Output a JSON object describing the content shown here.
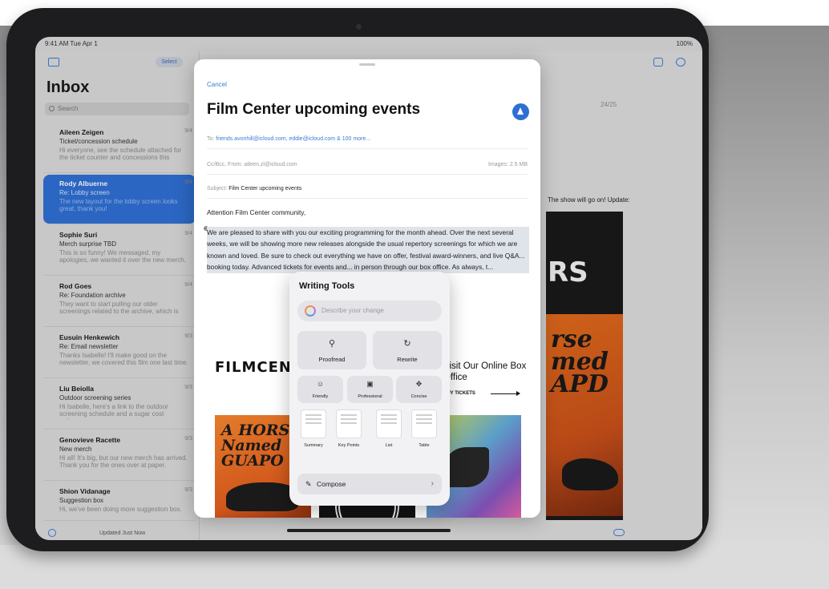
{
  "status_bar": {
    "time": "9:41 AM  Tue Apr 1",
    "battery": "100%"
  },
  "mailbox": {
    "select_label": "Select",
    "title": "Inbox",
    "search_placeholder": "Search",
    "updated": "Updated Just Now",
    "rows": [
      {
        "sender": "Aileen Zeigen",
        "subject": "Ticket/concession schedule",
        "preview": "Hi everyone, see the schedule attached for the ticket counter and concessions this",
        "date": "9/4"
      },
      {
        "sender": "Rody Albuerne",
        "subject": "Re: Lobby screen",
        "preview": "The new layout for the lobby screen looks great, thank you!",
        "date": "9/4"
      },
      {
        "sender": "Sophie Suri",
        "subject": "Merch surprise TBD",
        "preview": "This is so funny! We messaged, my apologies, we wanted it over the new merch.",
        "date": "9/4"
      },
      {
        "sender": "Rod Goes",
        "subject": "Re: Foundation archive",
        "preview": "They want to start pulling our older screenings related to the archive, which is",
        "date": "9/4"
      },
      {
        "sender": "Eusuin Henkewich",
        "subject": "Re: Email newsletter",
        "preview": "Thanks Isabelle! I'll make good on the newsletter, we covered this film one last time.",
        "date": "9/3"
      },
      {
        "sender": "Liu Beiolla",
        "subject": "Outdoor screening series",
        "preview": "Hi Isabelle, here's a link to the outdoor screening schedule and a sugar cost estimate",
        "date": "9/3"
      },
      {
        "sender": "Genovieve Racette",
        "subject": "New merch",
        "preview": "Hi all! It's big, but our new merch has arrived. Thank you for the ones over at paper.",
        "date": "9/3"
      },
      {
        "sender": "Shion Vidanage",
        "subject": "Suggestion box",
        "preview": "Hi, we've been doing more suggestion box.",
        "date": "9/3"
      }
    ]
  },
  "detail": {
    "date": "24/25",
    "show_text": "The show will go on! Update:",
    "poster_text": "RS",
    "poster_title": "rse med APD"
  },
  "compose": {
    "cancel": "Cancel",
    "title": "Film Center upcoming events",
    "to_label": "To:",
    "to_value": "friends.avonhill@icloud.com, eddie@icloud.com & 100 more...",
    "cc_line": "Cc/Bcc, From: aileen.zl@icloud.com",
    "images": "Images: 2.5 MB",
    "subject_label": "Subject:",
    "subject_value": "Film Center upcoming events",
    "greeting": "Attention Film Center community,",
    "paragraph": "We are pleased to share with you our exciting programming for the month ahead. Over the next several weeks, we will be showing more new releases alongside the usual repertory screenings for which we are known and loved. Be sure to check out everything we have on offer, festival award-winners, and live Q&A... booking today. Advanced tickets for events and... in person through our box office. As always, t...",
    "banner_logo": "FILMCENTER",
    "banner_visit": "Visit Our Online Box Office",
    "banner_buy": "BUY TICKETS",
    "poster_a_text": "A HORSE Named GUAPO"
  },
  "writing_tools": {
    "heading": "Writing Tools",
    "describe_placeholder": "Describe your change",
    "big_tools": [
      {
        "label": "Proofread",
        "icon": "magnifier-icon"
      },
      {
        "label": "Rewrite",
        "icon": "rewrite-icon"
      }
    ],
    "tone_tools": [
      {
        "label": "Friendly",
        "icon": "smile-icon"
      },
      {
        "label": "Professional",
        "icon": "briefcase-icon"
      },
      {
        "label": "Concise",
        "icon": "concise-icon"
      }
    ],
    "format_tools": [
      "Summary",
      "Key Points",
      "List",
      "Table"
    ],
    "compose": "Compose"
  }
}
